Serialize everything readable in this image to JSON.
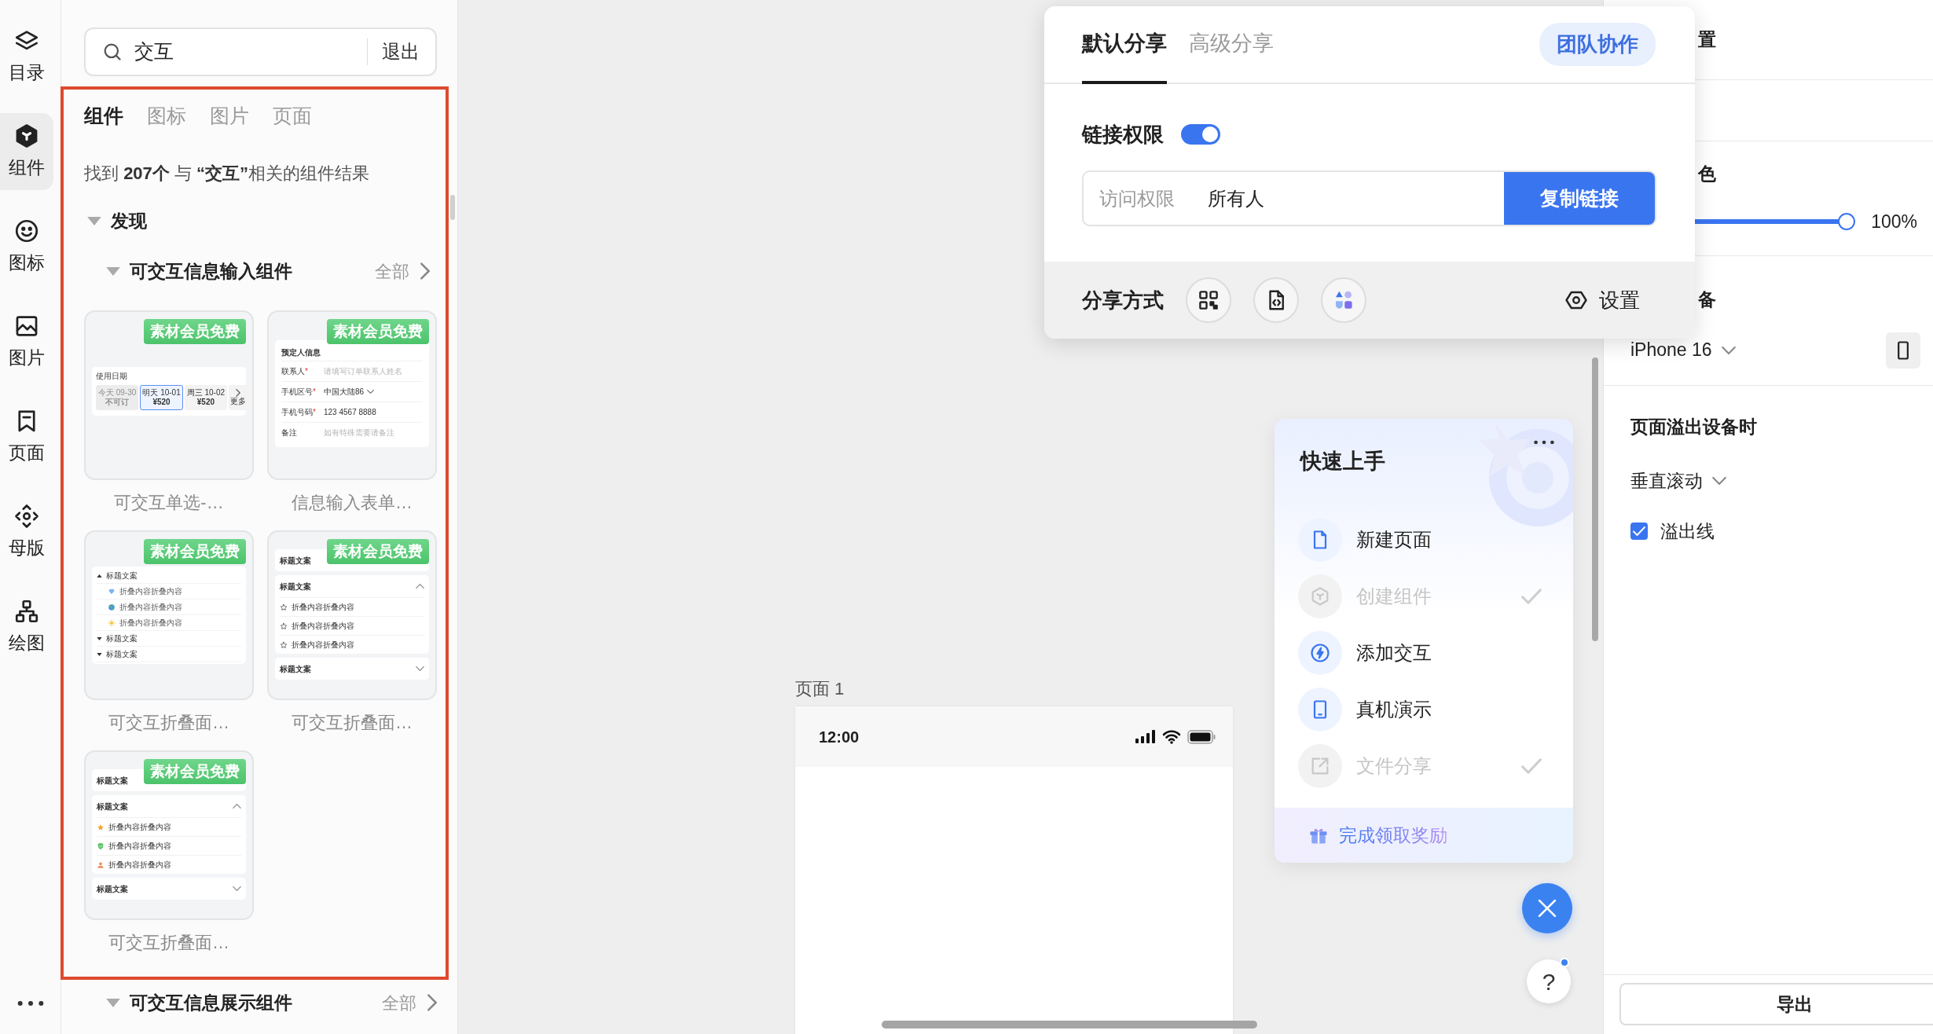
{
  "rail": {
    "items": [
      {
        "label": "目录",
        "kind": "layers",
        "selected": false
      },
      {
        "label": "组件",
        "kind": "component",
        "selected": true
      },
      {
        "label": "图标",
        "kind": "smiley",
        "selected": false
      },
      {
        "label": "图片",
        "kind": "image",
        "selected": false
      },
      {
        "label": "页面",
        "kind": "bookmark",
        "selected": false
      },
      {
        "label": "母版",
        "kind": "master",
        "selected": false
      },
      {
        "label": "绘图",
        "kind": "diagram",
        "selected": false
      }
    ]
  },
  "search": {
    "value": "交互",
    "exit": "退出"
  },
  "library": {
    "tabs": [
      {
        "label": "组件",
        "selected": true
      },
      {
        "label": "图标",
        "selected": false
      },
      {
        "label": "图片",
        "selected": false
      },
      {
        "label": "页面",
        "selected": false
      }
    ],
    "result": "找到 **207个** 与 **“交互”**相关的组件结果",
    "group": {
      "label": "发现",
      "expanded": true
    },
    "sections": [
      {
        "title": "可交互信息输入组件",
        "expanded": true,
        "more": "全部",
        "cards": [
          {
            "badge": "素材会员免费",
            "title": "可交互单选-…",
            "preview": {
              "kind": "date-picker",
              "heading": "使用日期",
              "options": [
                {
                  "day": "今天 09-30",
                  "price": "不可订",
                  "disabled": true,
                  "selected": false
                },
                {
                  "day": "明天 10-01",
                  "price": "¥520",
                  "disabled": false,
                  "selected": true
                },
                {
                  "day": "周三 10-02",
                  "price": "¥520",
                  "disabled": false,
                  "selected": false
                }
              ],
              "more": "更多"
            }
          },
          {
            "badge": "素材会员免费",
            "title": "信息输入表单…",
            "preview": {
              "kind": "form",
              "heading": "预定人信息",
              "fields": [
                {
                  "kind": "text",
                  "label": "联系人",
                  "required_mark": "*",
                  "placeholder": "请填写订单联系人姓名"
                },
                {
                  "kind": "select",
                  "label": "手机区号",
                  "required_mark": "*",
                  "value": "中国大陆86"
                },
                {
                  "kind": "text",
                  "label": "手机号码",
                  "required_mark": "*",
                  "value": "123 4567 8888"
                },
                {
                  "kind": "text",
                  "label": "备注",
                  "placeholder": "如有特殊需要请备注"
                }
              ]
            }
          },
          {
            "badge": "素材会员免费",
            "title": "可交互折叠面…",
            "preview": {
              "kind": "tree",
              "nodes": [
                {
                  "label": "标题文案",
                  "expanded": true,
                  "children": [
                    {
                      "label": "折叠内容折叠内容",
                      "kind": "diamond"
                    },
                    {
                      "label": "折叠内容折叠内容",
                      "kind": "globe"
                    },
                    {
                      "label": "折叠内容折叠内容",
                      "kind": "sun"
                    }
                  ]
                },
                {
                  "label": "标题文案",
                  "expanded": false
                },
                {
                  "label": "标题文案",
                  "expanded": false
                }
              ]
            }
          },
          {
            "badge": "素材会员免费",
            "title": "可交互折叠面…",
            "preview": {
              "kind": "accordion",
              "panels": [
                {
                  "kind": "header",
                  "title": "标题文案"
                },
                {
                  "kind": "panel",
                  "title": "标题文案",
                  "expanded": true,
                  "items": [
                    {
                      "label": "折叠内容折叠内容",
                      "kind": "star-outline"
                    },
                    {
                      "label": "折叠内容折叠内容",
                      "kind": "star-outline"
                    },
                    {
                      "label": "折叠内容折叠内容",
                      "kind": "star-outline"
                    }
                  ]
                },
                {
                  "kind": "panel",
                  "title": "标题文案",
                  "expanded": false
                }
              ]
            }
          },
          {
            "badge": "素材会员免费",
            "title": "可交互折叠面…",
            "preview": {
              "kind": "accordion",
              "panels": [
                {
                  "kind": "header",
                  "title": "标题文案"
                },
                {
                  "kind": "panel",
                  "title": "标题文案",
                  "expanded": true,
                  "items": [
                    {
                      "label": "折叠内容折叠内容",
                      "kind": "star"
                    },
                    {
                      "label": "折叠内容折叠内容",
                      "kind": "shield"
                    },
                    {
                      "label": "折叠内容折叠内容",
                      "kind": "person"
                    }
                  ]
                },
                {
                  "kind": "panel",
                  "title": "标题文案",
                  "expanded": false
                }
              ]
            }
          }
        ]
      },
      {
        "title": "可交互信息展示组件",
        "expanded": true,
        "more": "全部"
      }
    ]
  },
  "canvas": {
    "page_label": "页面 1",
    "phone": {
      "time": "12:00"
    }
  },
  "share_popup": {
    "tabs": [
      {
        "label": "默认分享",
        "selected": true
      },
      {
        "label": "高级分享",
        "selected": false
      }
    ],
    "team_button": "团队协作",
    "link_permission": {
      "label": "链接权限",
      "on": true
    },
    "access": {
      "label": "访问权限",
      "value": "所有人",
      "button": "复制链接"
    },
    "share_methods": {
      "label": "分享方式",
      "options": [
        {
          "kind": "qr"
        },
        {
          "kind": "code-file"
        },
        {
          "kind": "shapes"
        }
      ]
    },
    "settings": "设置"
  },
  "quick_start": {
    "title": "快速上手",
    "tasks": [
      {
        "label": "新建页面",
        "kind": "file",
        "done": false
      },
      {
        "label": "创建组件",
        "kind": "component-outline",
        "done": true
      },
      {
        "label": "添加交互",
        "kind": "bolt",
        "done": false
      },
      {
        "label": "真机演示",
        "kind": "tablet",
        "done": false
      },
      {
        "label": "文件分享",
        "kind": "share",
        "done": true
      }
    ],
    "reward": "完成领取奖励"
  },
  "help": "?",
  "properties": {
    "title_fragment": "置",
    "fill": {
      "label_fragment": "色",
      "level": 1,
      "reading": "100%"
    },
    "device": {
      "label_fragment": "备",
      "model": "iPhone 16"
    },
    "overflow": {
      "title": "页面溢出设备时",
      "mode": "垂直滚动",
      "overflow_line": {
        "label": "溢出线",
        "checked": true
      }
    },
    "export": "导出"
  }
}
